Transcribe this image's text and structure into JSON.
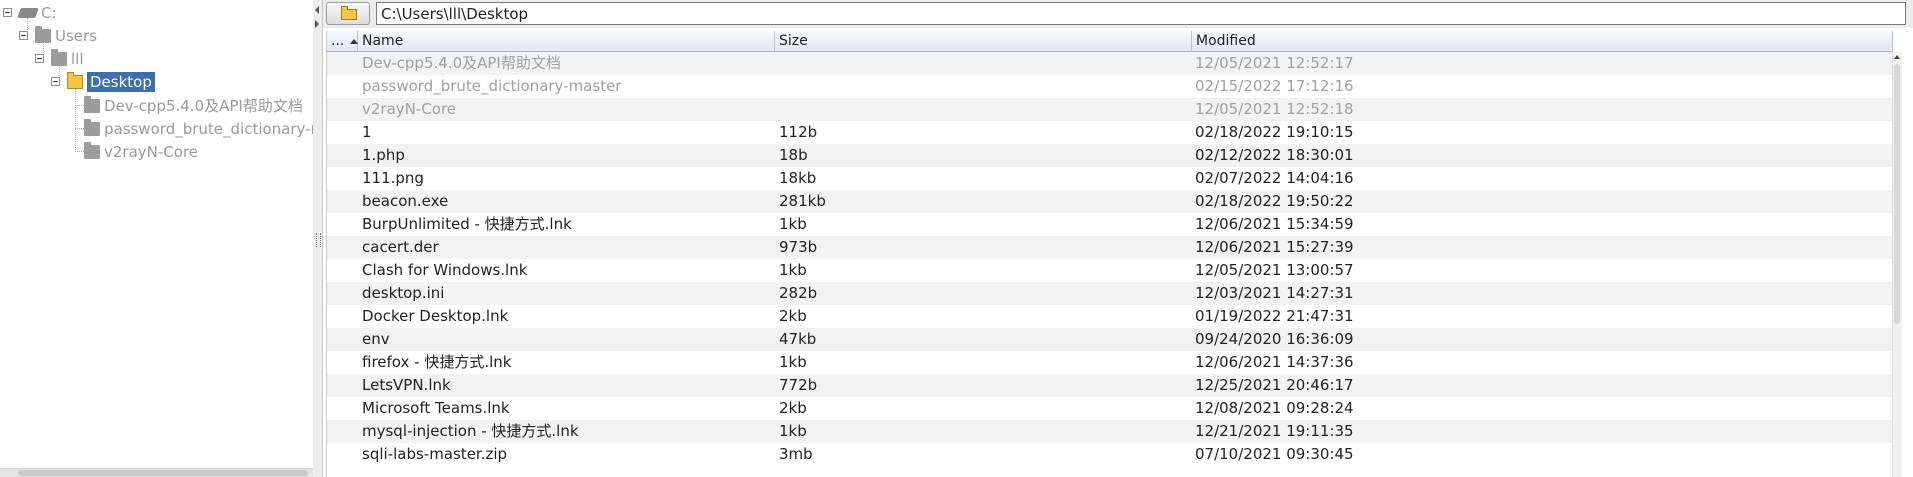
{
  "tree": {
    "nodes": [
      {
        "label": "C:",
        "icon": "drive-icon",
        "level": 0
      },
      {
        "label": "Users",
        "icon": "folder-icon",
        "level": 1
      },
      {
        "label": "lll",
        "icon": "folder-icon",
        "level": 2
      },
      {
        "label": "Desktop",
        "icon": "folder-open-icon",
        "level": 3,
        "selected": true
      },
      {
        "label": "Dev-cpp5.4.0及API帮助文档",
        "icon": "folder-icon",
        "level": 4
      },
      {
        "label": "password_brute_dictionary-master",
        "icon": "folder-icon",
        "level": 4
      },
      {
        "label": "v2rayN-Core",
        "icon": "folder-icon",
        "level": 4
      }
    ]
  },
  "path_bar": {
    "path": "C:\\Users\\lll\\Desktop",
    "folder_button_icon": "folder-icon"
  },
  "table": {
    "columns": {
      "parent": "...",
      "name": "Name",
      "size": "Size",
      "modified": "Modified"
    },
    "sort": {
      "column": "parent",
      "direction": "ascending"
    },
    "rows": [
      {
        "type": "dir",
        "name": "Dev-cpp5.4.0及API帮助文档",
        "size": "",
        "modified": "12/05/2021 12:52:17"
      },
      {
        "type": "dir",
        "name": "password_brute_dictionary-master",
        "size": "",
        "modified": "02/15/2022 17:12:16"
      },
      {
        "type": "dir",
        "name": "v2rayN-Core",
        "size": "",
        "modified": "12/05/2021 12:52:18"
      },
      {
        "type": "file",
        "name": "1",
        "size": "112b",
        "modified": "02/18/2022 19:10:15"
      },
      {
        "type": "file",
        "name": "1.php",
        "size": "18b",
        "modified": "02/12/2022 18:30:01"
      },
      {
        "type": "file",
        "name": "111.png",
        "size": "18kb",
        "modified": "02/07/2022 14:04:16"
      },
      {
        "type": "file",
        "name": "beacon.exe",
        "size": "281kb",
        "modified": "02/18/2022 19:50:22"
      },
      {
        "type": "file",
        "name": "BurpUnlimited - 快捷方式.lnk",
        "size": "1kb",
        "modified": "12/06/2021 15:34:59"
      },
      {
        "type": "file",
        "name": "cacert.der",
        "size": "973b",
        "modified": "12/06/2021 15:27:39"
      },
      {
        "type": "file",
        "name": "Clash for Windows.lnk",
        "size": "1kb",
        "modified": "12/05/2021 13:00:57"
      },
      {
        "type": "file",
        "name": "desktop.ini",
        "size": "282b",
        "modified": "12/03/2021 14:27:31"
      },
      {
        "type": "file",
        "name": "Docker Desktop.lnk",
        "size": "2kb",
        "modified": "01/19/2022 21:47:31"
      },
      {
        "type": "file",
        "name": "env",
        "size": "47kb",
        "modified": "09/24/2020 16:36:09"
      },
      {
        "type": "file",
        "name": "firefox - 快捷方式.lnk",
        "size": "1kb",
        "modified": "12/06/2021 14:37:36"
      },
      {
        "type": "file",
        "name": "LetsVPN.lnk",
        "size": "772b",
        "modified": "12/25/2021 20:46:17"
      },
      {
        "type": "file",
        "name": "Microsoft Teams.lnk",
        "size": "2kb",
        "modified": "12/08/2021 09:28:24"
      },
      {
        "type": "file",
        "name": "mysql-injection - 快捷方式.lnk",
        "size": "1kb",
        "modified": "12/21/2021 19:11:35"
      },
      {
        "type": "file",
        "name": "sqli-labs-master.zip",
        "size": "3mb",
        "modified": "07/10/2021 09:30:45"
      }
    ]
  },
  "colors": {
    "selection": "#3d6fa8",
    "header_bg": "#e3e9f1",
    "folder_yellow": "#f4c542",
    "dim_text": "#a0a0a0"
  }
}
